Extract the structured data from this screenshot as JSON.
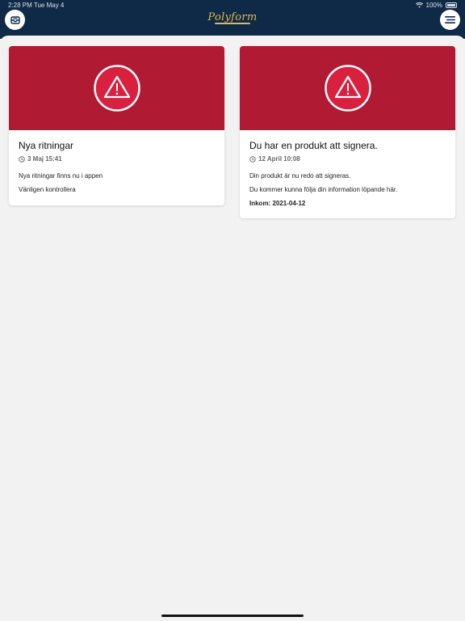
{
  "status_bar": {
    "time": "2:28 PM",
    "date": "Tue May 4",
    "battery": "100%"
  },
  "header": {
    "logo_text": "Polyform",
    "left_button_icon": "inbox-icon",
    "right_button_icon": "menu-icon",
    "background": "#0f2a46",
    "logo_color": "#e4b84a"
  },
  "cards": [
    {
      "icon": "warning-icon",
      "hero_color": "#b01a33",
      "title": "Nya ritningar",
      "date": "3 Maj 15:41",
      "lines": [
        "Nya ritningar finns nu i appen",
        "Vänligen kontrollera"
      ]
    },
    {
      "icon": "warning-icon",
      "hero_color": "#b01a33",
      "title": "Du har en produkt att signera.",
      "date": "12 April 10:08",
      "lines": [
        "Din produkt är nu redo att signeras.",
        "Du kommer kunna följa din information löpande här."
      ],
      "received": "Inkom: 2021-04-12"
    }
  ]
}
